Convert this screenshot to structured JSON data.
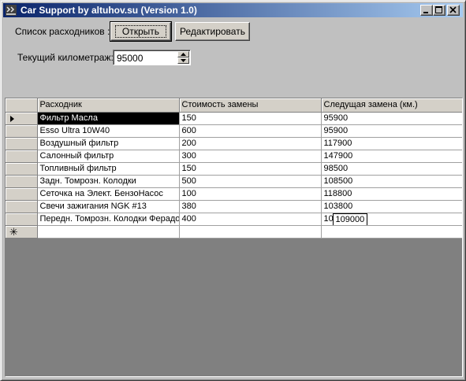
{
  "window": {
    "title": "Car Support by altuhov.su (Version 1.0)"
  },
  "toolbar": {
    "list_label": "Список расходников :",
    "open_label": "Открыть",
    "edit_label": "Редактировать"
  },
  "mileage": {
    "label": "Текущий километраж:",
    "value": "95000"
  },
  "grid": {
    "columns": [
      "Расходник",
      "Стоимость замены",
      "Следущая замена (км.)"
    ],
    "rows": [
      {
        "name": "Фильтр Масла",
        "cost": "150",
        "next": "95900"
      },
      {
        "name": "Esso Ultra 10W40",
        "cost": "600",
        "next": "95900"
      },
      {
        "name": "Воздушный фильтр",
        "cost": "200",
        "next": "117900"
      },
      {
        "name": "Салонный фильтр",
        "cost": "300",
        "next": "147900"
      },
      {
        "name": "Топливный фильтр",
        "cost": "150",
        "next": "98500"
      },
      {
        "name": "Задн. Томрозн. Колодки",
        "cost": "500",
        "next": "108500"
      },
      {
        "name": "Сеточка на Элект. БензоНасос",
        "cost": "100",
        "next": "118800"
      },
      {
        "name": "Свечи зажигания NGK #13",
        "cost": "380",
        "next": "103800"
      },
      {
        "name": "Передн. Томрозн. Колодки Ферадо",
        "cost": "400",
        "next": "10",
        "edit_value": "109000"
      }
    ]
  },
  "icons": {
    "app": "app-icon",
    "minimize": "minimize-icon",
    "maximize": "maximize-icon",
    "close": "close-icon",
    "row_pointer": "row-pointer-icon",
    "new_row": "new-row-icon"
  }
}
